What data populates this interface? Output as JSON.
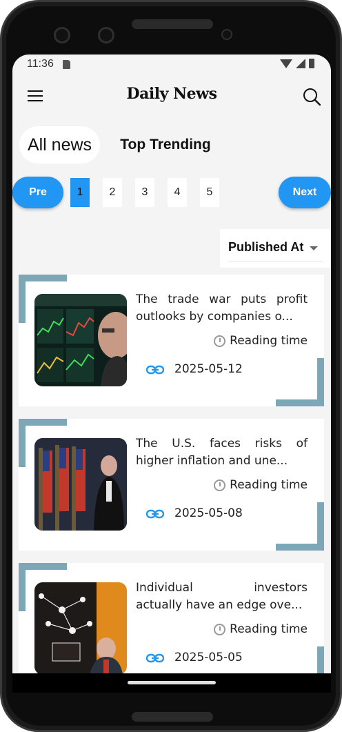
{
  "status": {
    "time": "11:36"
  },
  "app": {
    "title": "Daily News"
  },
  "tabs": {
    "all_news": "All news",
    "top_trending": "Top Trending"
  },
  "pager": {
    "prev": "Pre",
    "next": "Next",
    "pages": [
      "1",
      "2",
      "3",
      "4",
      "5"
    ],
    "current_page": "1"
  },
  "sort": {
    "label": "Published At"
  },
  "articles": [
    {
      "headline_line1": "The trade war puts profit",
      "headline_line2": "outlooks by companies o...",
      "reading": "Reading time",
      "date": "2025-05-12"
    },
    {
      "headline_line1": "The U.S. faces risks of",
      "headline_line2": "higher inflation and une...",
      "reading": "Reading time",
      "date": "2025-05-08"
    },
    {
      "headline_line1": "Individual investors",
      "headline_line2": "actually have an edge ove...",
      "reading": "Reading time",
      "date": "2025-05-05"
    }
  ],
  "colors": {
    "accent": "#2196f3",
    "corner": "#7da6b6",
    "background": "#f4f4f4"
  },
  "icons": [
    "menu-icon",
    "search-icon",
    "timer-icon",
    "link-icon",
    "wifi-icon",
    "signal-icon",
    "battery-icon",
    "sd-card-icon"
  ]
}
